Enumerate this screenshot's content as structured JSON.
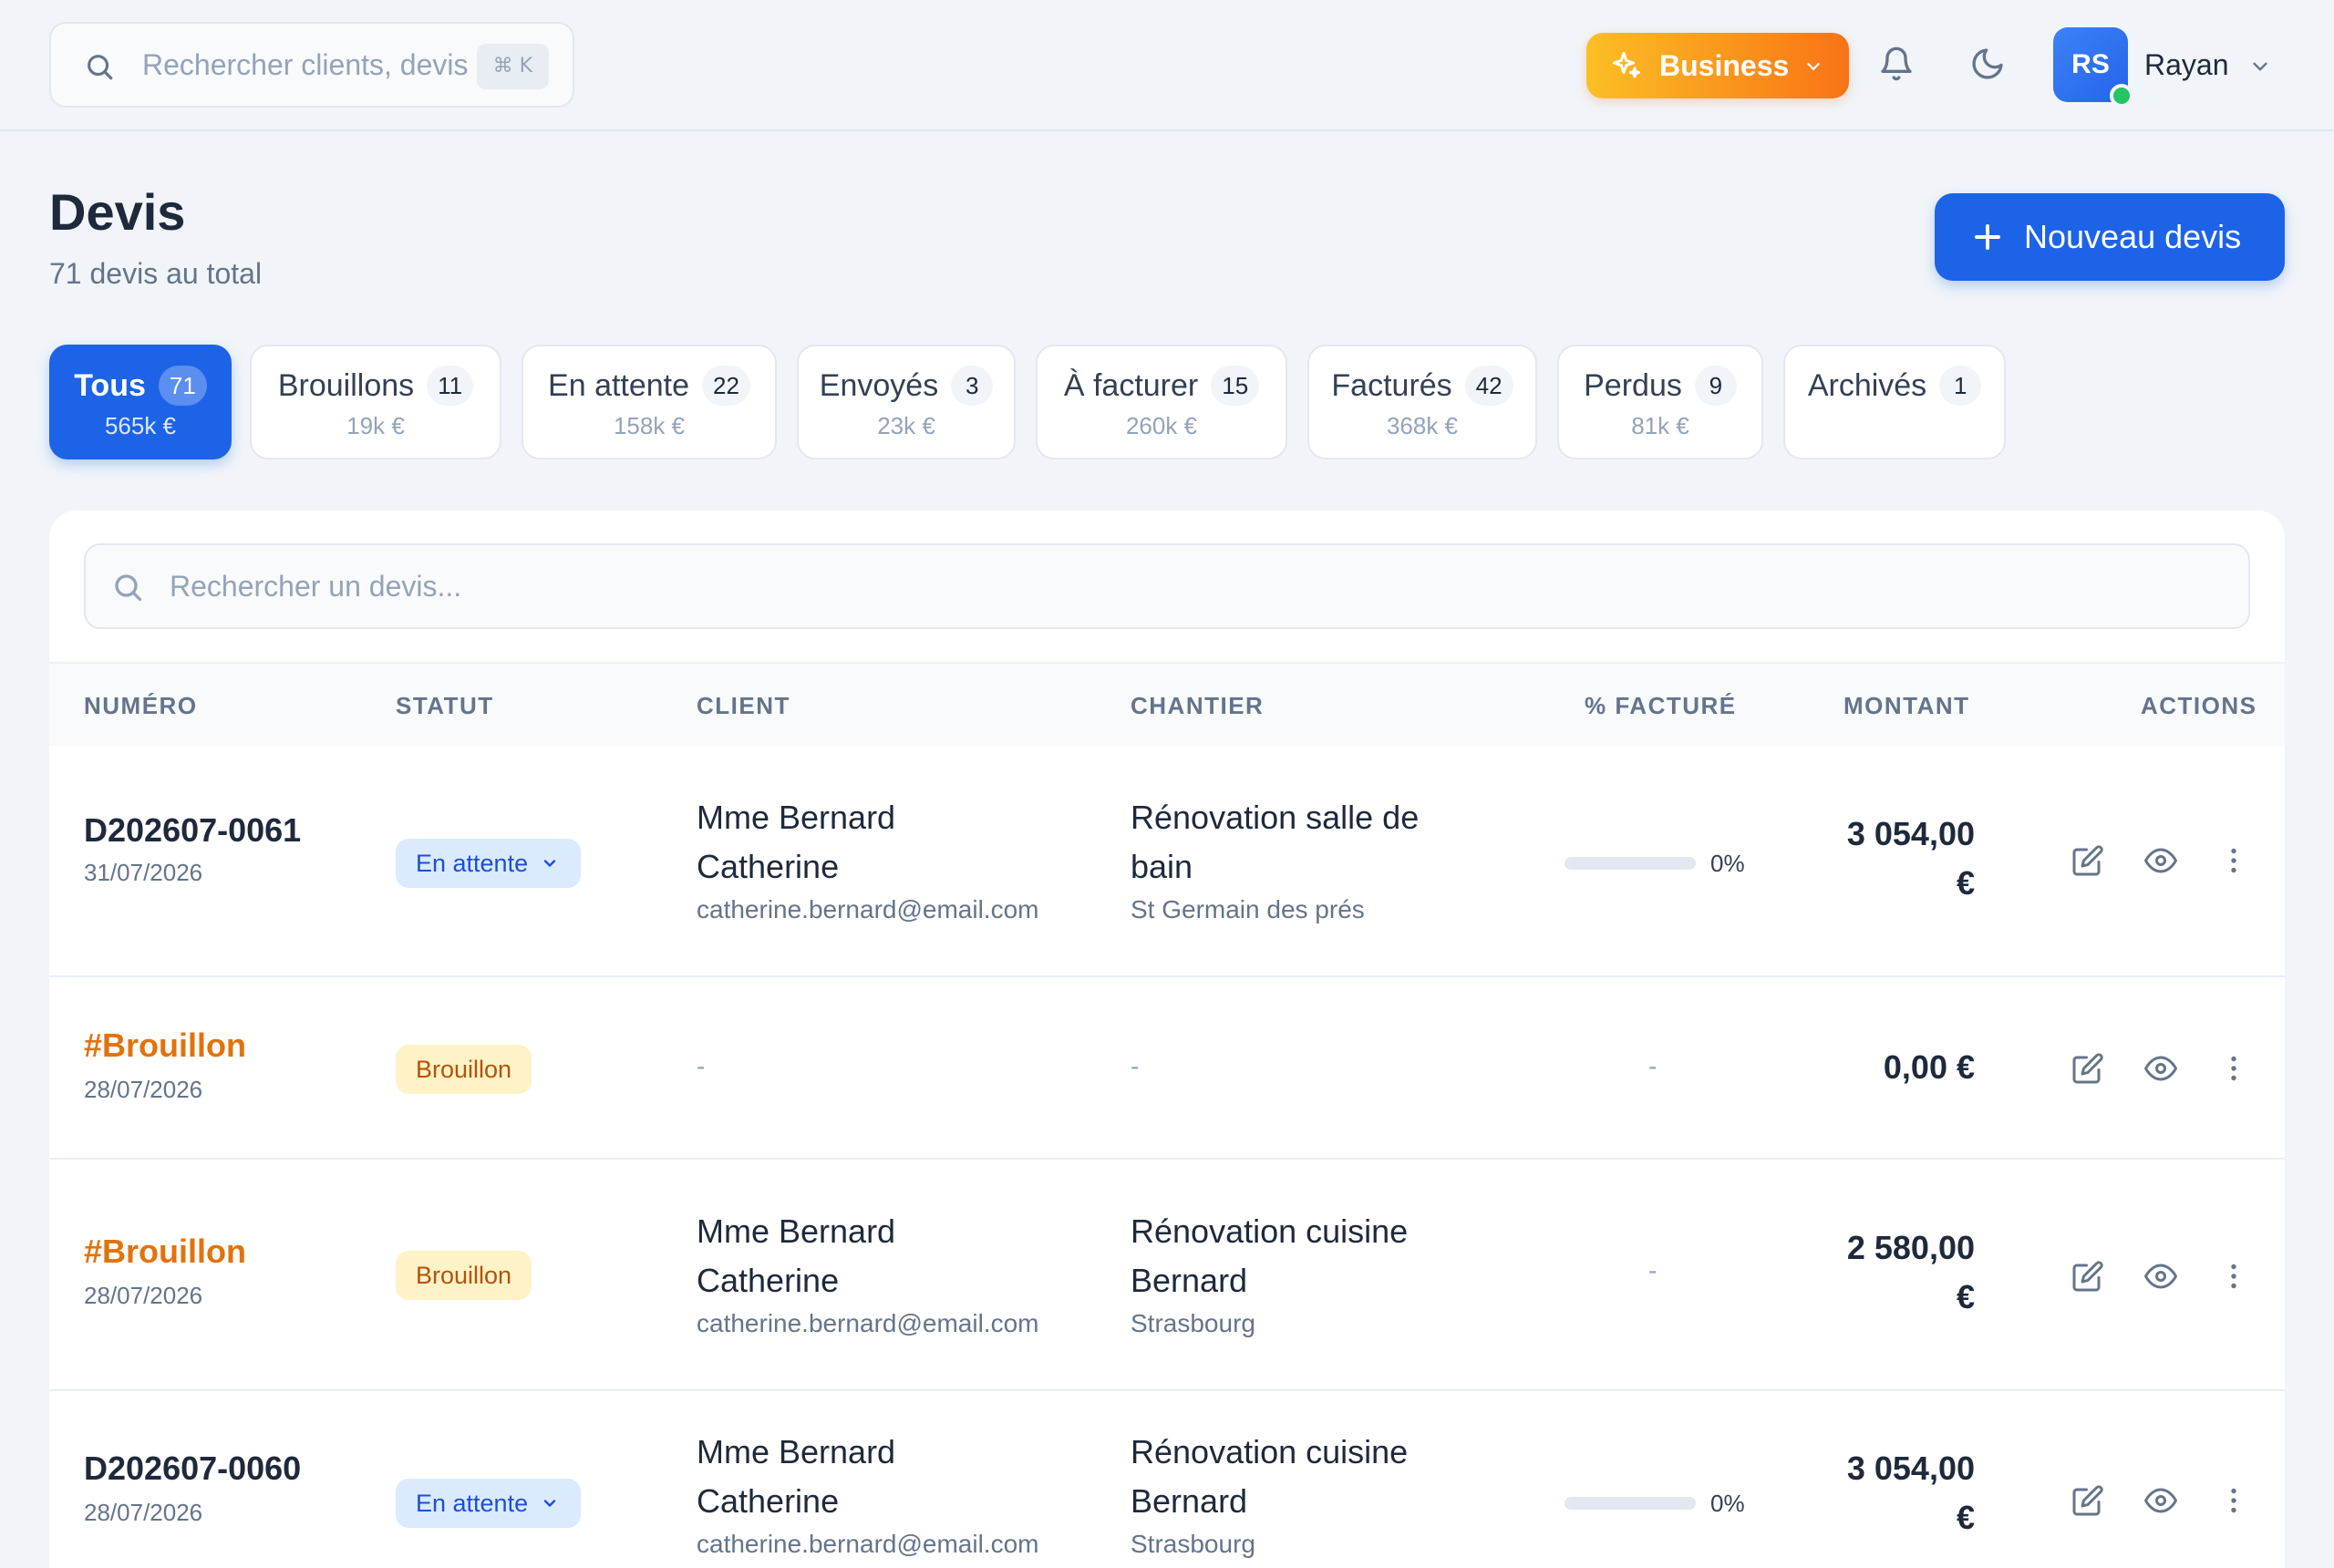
{
  "topbar": {
    "search_placeholder": "Rechercher clients, devis",
    "search_shortcut": "⌘ K",
    "plan_label": "Business",
    "user_initials": "RS",
    "user_name": "Rayan"
  },
  "header": {
    "title": "Devis",
    "subtitle": "71 devis au total",
    "new_button_label": "Nouveau devis"
  },
  "tabs": [
    {
      "label": "Tous",
      "count": "71",
      "amount": "565k €",
      "active": true
    },
    {
      "label": "Brouillons",
      "count": "11",
      "amount": "19k €"
    },
    {
      "label": "En attente",
      "count": "22",
      "amount": "158k €"
    },
    {
      "label": "Envoyés",
      "count": "3",
      "amount": "23k €"
    },
    {
      "label": "À facturer",
      "count": "15",
      "amount": "260k €"
    },
    {
      "label": "Facturés",
      "count": "42",
      "amount": "368k €"
    },
    {
      "label": "Perdus",
      "count": "9",
      "amount": "81k €"
    },
    {
      "label": "Archivés",
      "count": "1",
      "amount": ""
    }
  ],
  "list": {
    "search_placeholder": "Rechercher un devis...",
    "columns": [
      "NUMÉRO",
      "STATUT",
      "CLIENT",
      "CHANTIER",
      "% FACTURÉ",
      "MONTANT",
      "ACTIONS"
    ],
    "rows": [
      {
        "number": "D202607-0061",
        "date": "31/07/2026",
        "status": "En attente",
        "client_line1": "Mme Bernard",
        "client_line2": "Catherine",
        "client_email": "catherine.bernard@email.com",
        "site_line1": "Rénovation salle de",
        "site_line2": "bain",
        "site_city": "St Germain des prés",
        "billed_pct": "0%",
        "billed_fraction": 0,
        "amount_line1": "3 054,00",
        "amount_line2": "€"
      },
      {
        "number": "#Brouillon",
        "date": "28/07/2026",
        "status": "Brouillon",
        "client_dash": "-",
        "site_dash": "-",
        "billed_dash": "-",
        "amount": "0,00 €"
      },
      {
        "number": "#Brouillon",
        "date": "28/07/2026",
        "status": "Brouillon",
        "client_line1": "Mme Bernard",
        "client_line2": "Catherine",
        "client_email": "catherine.bernard@email.com",
        "site_line1": "Rénovation cuisine",
        "site_line2": "Bernard",
        "site_city": "Strasbourg",
        "billed_dash": "-",
        "amount_line1": "2 580,00",
        "amount_line2": "€"
      },
      {
        "number": "D202607-0060",
        "date": "28/07/2026",
        "status": "En attente",
        "client_line1": "Mme Bernard",
        "client_line2": "Catherine",
        "client_email": "catherine.bernard@email.com",
        "site_line1": "Rénovation cuisine",
        "site_line2": "Bernard",
        "site_city": "Strasbourg",
        "billed_pct": "0%",
        "billed_fraction": 0,
        "amount_line1": "3 054,00",
        "amount_line2": "€"
      }
    ]
  },
  "colors": {
    "primary": "#1d63e8",
    "draft_orange": "#e2730c",
    "pending_bg": "#dbeafe",
    "draft_bg": "#fef3c7",
    "online": "#22c55e"
  },
  "icons": [
    "search-icon",
    "sparkles-icon",
    "chevron-down-icon",
    "bell-icon",
    "moon-icon",
    "plus-icon",
    "edit-icon",
    "eye-icon",
    "more-vertical-icon"
  ]
}
